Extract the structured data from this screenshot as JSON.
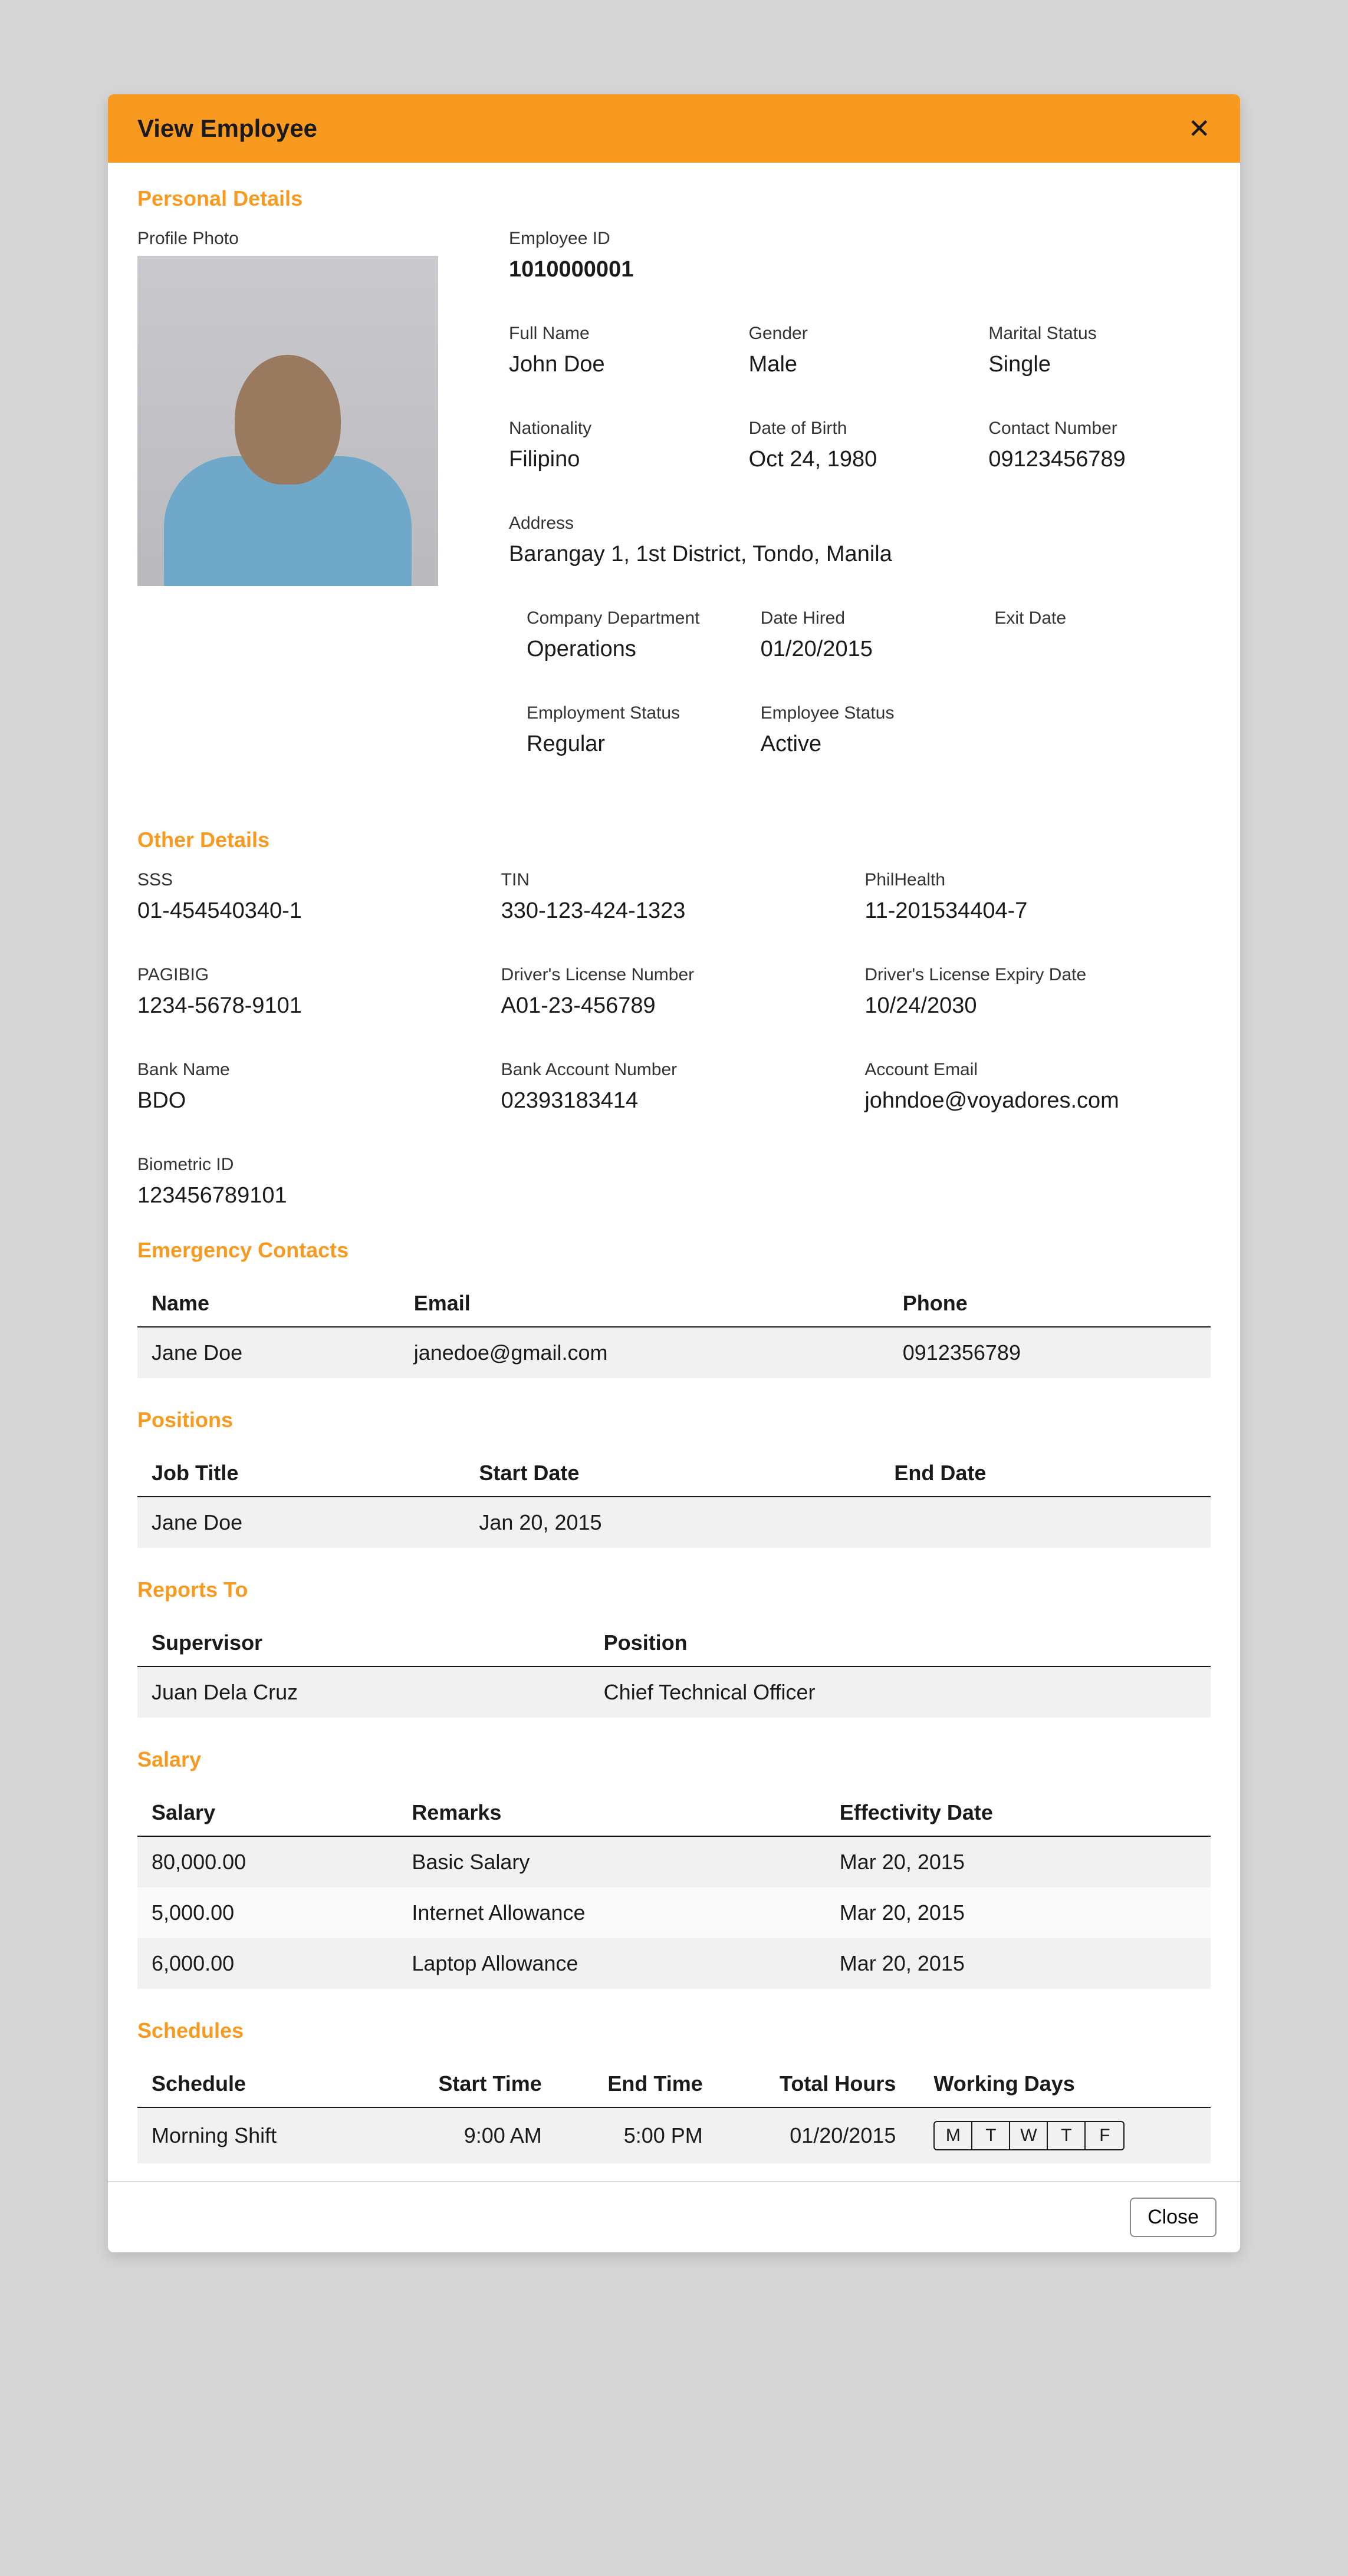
{
  "header": {
    "title": "View Employee"
  },
  "sections": {
    "personal": "Personal Details",
    "other": "Other Details",
    "emergency": "Emergency Contacts",
    "positions": "Positions",
    "reports": "Reports To",
    "salary": "Salary",
    "schedules": "Schedules"
  },
  "labels": {
    "profile_photo": "Profile Photo",
    "employee_id": "Employee ID",
    "full_name": "Full Name",
    "gender": "Gender",
    "marital_status": "Marital Status",
    "nationality": "Nationality",
    "dob": "Date of Birth",
    "contact_number": "Contact Number",
    "address": "Address",
    "company_department": "Company Department",
    "date_hired": "Date Hired",
    "exit_date": "Exit Date",
    "employment_status": "Employment Status",
    "employee_status": "Employee Status",
    "sss": "SSS",
    "tin": "TIN",
    "philhealth": "PhilHealth",
    "pagibig": "PAGIBIG",
    "dl_number": "Driver's License Number",
    "dl_expiry": "Driver's License Expiry Date",
    "bank_name": "Bank Name",
    "bank_account": "Bank Account Number",
    "account_email": "Account Email",
    "biometric_id": "Biometric ID"
  },
  "personal": {
    "employee_id": "1010000001",
    "full_name": "John Doe",
    "gender": "Male",
    "marital_status": "Single",
    "nationality": "Filipino",
    "dob": "Oct 24, 1980",
    "contact_number": "09123456789",
    "address": "Barangay 1, 1st District, Tondo, Manila",
    "company_department": "Operations",
    "date_hired": "01/20/2015",
    "exit_date": "",
    "employment_status": "Regular",
    "employee_status": "Active"
  },
  "other": {
    "sss": "01-454540340-1",
    "tin": "330-123-424-1323",
    "philhealth": "11-201534404-7",
    "pagibig": "1234-5678-9101",
    "dl_number": "A01-23-456789",
    "dl_expiry": "10/24/2030",
    "bank_name": "BDO",
    "bank_account": "02393183414",
    "account_email": "johndoe@voyadores.com",
    "biometric_id": "123456789101"
  },
  "emergency": {
    "headers": {
      "name": "Name",
      "email": "Email",
      "phone": "Phone"
    },
    "rows": [
      {
        "name": "Jane Doe",
        "email": "janedoe@gmail.com",
        "phone": "0912356789"
      }
    ]
  },
  "positions": {
    "headers": {
      "job_title": "Job Title",
      "start_date": "Start Date",
      "end_date": "End Date"
    },
    "rows": [
      {
        "job_title": "Jane Doe",
        "start_date": "Jan 20, 2015",
        "end_date": ""
      }
    ]
  },
  "reports": {
    "headers": {
      "supervisor": "Supervisor",
      "position": "Position"
    },
    "rows": [
      {
        "supervisor": "Juan Dela Cruz",
        "position": "Chief Technical Officer"
      }
    ]
  },
  "salary": {
    "headers": {
      "salary": "Salary",
      "remarks": "Remarks",
      "effectivity": "Effectivity Date"
    },
    "rows": [
      {
        "salary": "80,000.00",
        "remarks": "Basic Salary",
        "effectivity": "Mar 20, 2015"
      },
      {
        "salary": "5,000.00",
        "remarks": "Internet Allowance",
        "effectivity": "Mar 20, 2015"
      },
      {
        "salary": "6,000.00",
        "remarks": "Laptop Allowance",
        "effectivity": "Mar 20, 2015"
      }
    ]
  },
  "schedules": {
    "headers": {
      "schedule": "Schedule",
      "start_time": "Start Time",
      "end_time": "End Time",
      "total_hours": "Total Hours",
      "working_days": "Working Days"
    },
    "rows": [
      {
        "schedule": "Morning Shift",
        "start_time": "9:00 AM",
        "end_time": "5:00 PM",
        "total_hours": "01/20/2015",
        "working_days": [
          "M",
          "T",
          "W",
          "T",
          "F"
        ]
      }
    ]
  },
  "footer": {
    "close": "Close"
  }
}
